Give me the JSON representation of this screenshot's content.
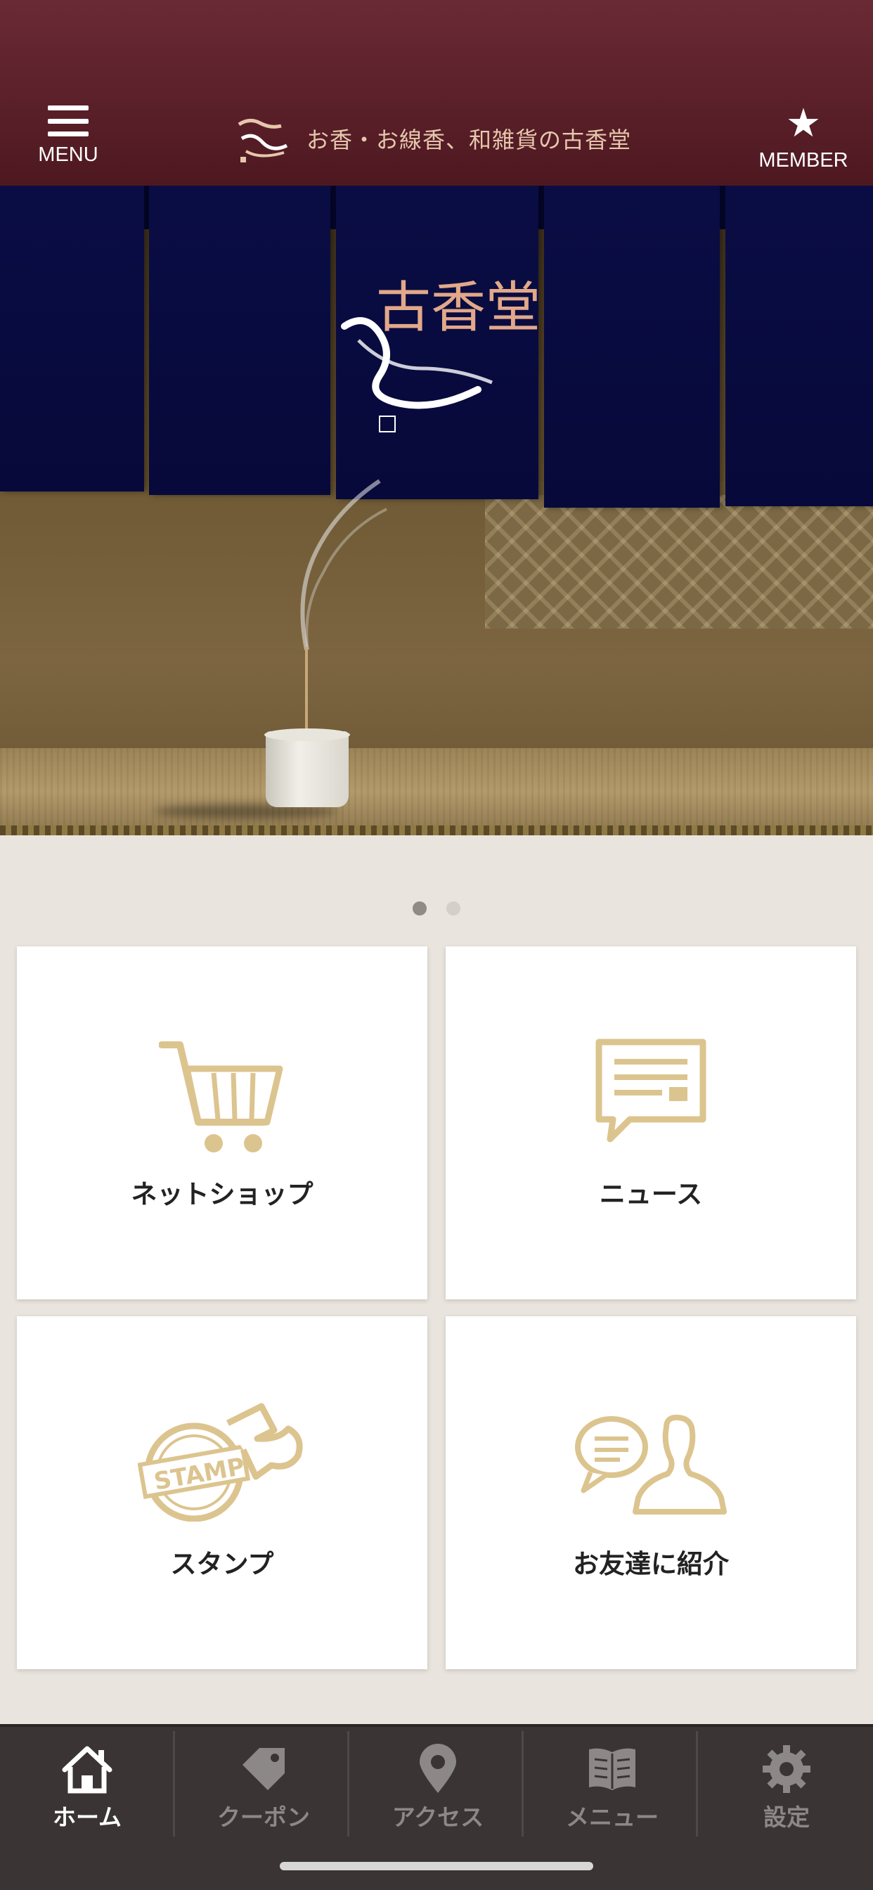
{
  "header": {
    "menu_label": "MENU",
    "member_label": "MEMBER",
    "brand_text": "お香・お線香、和雑貨の古香堂",
    "bg_color": "#5a1f29"
  },
  "hero": {
    "noren_logo_text": "古香堂",
    "slides_total": 2,
    "active_slide": 1
  },
  "tiles": [
    {
      "label": "ネットショップ",
      "icon": "shopping-cart-icon"
    },
    {
      "label": "ニュース",
      "icon": "news-bubble-icon"
    },
    {
      "label": "スタンプ",
      "icon": "stamp-icon"
    },
    {
      "label": "お友達に紹介",
      "icon": "friend-invite-icon"
    }
  ],
  "tabbar": {
    "tabs": [
      {
        "label": "ホーム",
        "icon": "home-icon",
        "active": true
      },
      {
        "label": "クーポン",
        "icon": "coupon-tag-icon",
        "active": false
      },
      {
        "label": "アクセス",
        "icon": "map-pin-icon",
        "active": false
      },
      {
        "label": "メニュー",
        "icon": "book-icon",
        "active": false
      },
      {
        "label": "設定",
        "icon": "gear-icon",
        "active": false
      }
    ]
  },
  "colors": {
    "accent_gold": "#dcc48f",
    "tab_active": "#ffffff",
    "tab_inactive": "#8d8888"
  }
}
